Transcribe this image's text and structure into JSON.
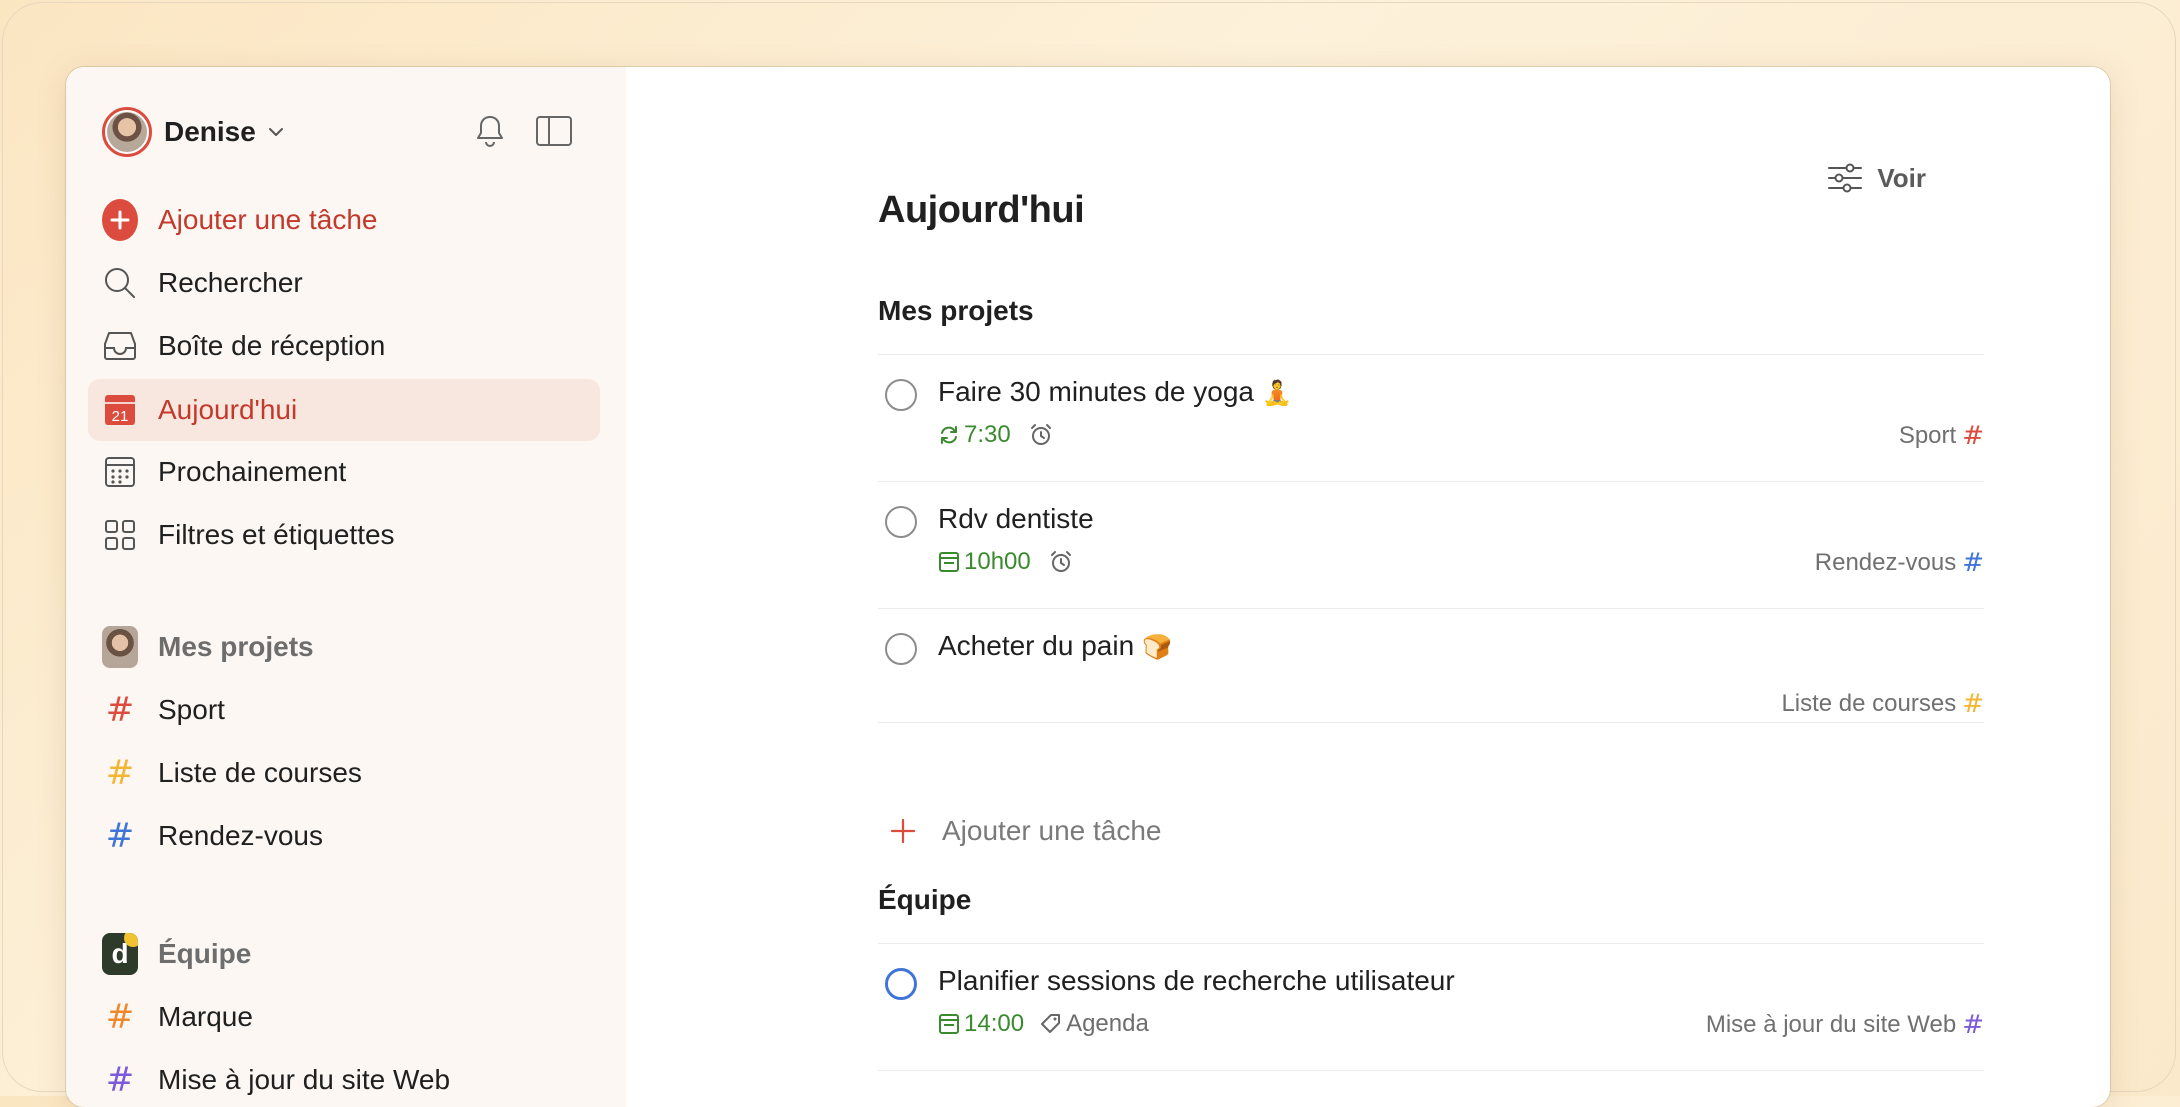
{
  "user": {
    "name": "Denise"
  },
  "nav": {
    "add_task": "Ajouter une tâche",
    "search": "Rechercher",
    "inbox": "Boîte de réception",
    "today": "Aujourd'hui",
    "today_date": "21",
    "upcoming": "Prochainement",
    "filters": "Filtres et étiquettes"
  },
  "sidebar_projects": {
    "heading": "Mes projets",
    "items": [
      {
        "label": "Sport",
        "color": "#dc4c3e"
      },
      {
        "label": "Liste de courses",
        "color": "#f2b632"
      },
      {
        "label": "Rendez-vous",
        "color": "#3f75d6"
      }
    ]
  },
  "sidebar_team": {
    "heading": "Équipe",
    "avatar_letter": "d",
    "items": [
      {
        "label": "Marque",
        "color": "#ef8a2c"
      },
      {
        "label": "Mise à jour du site Web",
        "color": "#7d5bd6"
      }
    ]
  },
  "main": {
    "view_label": "Voir",
    "title": "Aujourd'hui",
    "my_projects": {
      "heading": "Mes projets",
      "tasks": [
        {
          "title": "Faire 30 minutes de yoga",
          "emoji": "🧘",
          "time": "7:30",
          "project": "Sport",
          "project_color": "#dc4c3e"
        },
        {
          "title": "Rdv dentiste",
          "time": "10h00",
          "project": "Rendez-vous",
          "project_color": "#3f75d6"
        },
        {
          "title": "Acheter du pain",
          "emoji": "🍞",
          "project": "Liste de courses",
          "project_color": "#f2b632"
        }
      ],
      "add_task": "Ajouter une tâche"
    },
    "team": {
      "heading": "Équipe",
      "tasks": [
        {
          "title": "Planifier sessions de recherche utilisateur",
          "time": "14:00",
          "label": "Agenda",
          "project": "Mise à jour du site Web",
          "project_color": "#7d5bd6"
        }
      ]
    }
  }
}
